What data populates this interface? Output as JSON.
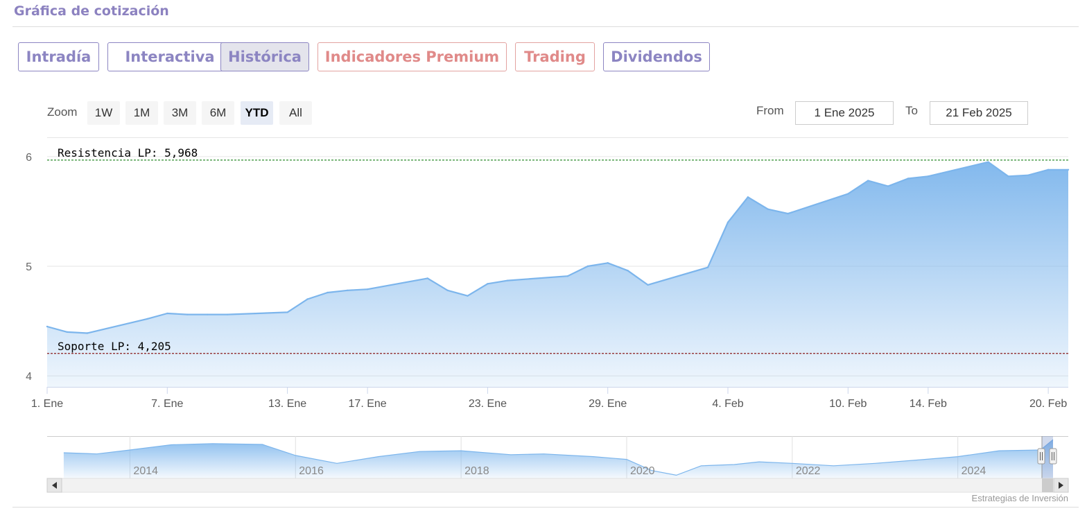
{
  "header": {
    "title": "Gráfica de cotización"
  },
  "tabs": [
    {
      "label": "Intradía"
    },
    {
      "label": "Interactiva"
    },
    {
      "label": "Histórica",
      "active": true
    },
    {
      "label": "Indicadores Premium"
    },
    {
      "label": "Trading"
    },
    {
      "label": "Dividendos"
    }
  ],
  "zoom": {
    "label": "Zoom",
    "buttons": [
      "1W",
      "1M",
      "3M",
      "6M",
      "YTD",
      "All"
    ],
    "selected": "YTD"
  },
  "range": {
    "from_label": "From",
    "from_value": "1 Ene 2025",
    "to_label": "To",
    "to_value": "21 Feb 2025"
  },
  "credits": "Estrategias de Inversión",
  "colors": {
    "accent": "#8c85c2",
    "premium": "#e08a89",
    "series": "#7cb5ec",
    "resistance": "#2e8b2e",
    "support": "#8b1c1c"
  },
  "chart_data": {
    "type": "area",
    "x": [
      "1. Ene",
      "2. Ene",
      "3. Ene",
      "6. Ene",
      "7. Ene",
      "8. Ene",
      "9. Ene",
      "10. Ene",
      "13. Ene",
      "14. Ene",
      "15. Ene",
      "16. Ene",
      "17. Ene",
      "20. Ene",
      "21. Ene",
      "22. Ene",
      "23. Ene",
      "24. Ene",
      "27. Ene",
      "28. Ene",
      "29. Ene",
      "30. Ene",
      "31. Ene",
      "3. Feb",
      "4. Feb",
      "5. Feb",
      "6. Feb",
      "7. Feb",
      "10. Feb",
      "11. Feb",
      "12. Feb",
      "13. Feb",
      "14. Feb",
      "17. Feb",
      "18. Feb",
      "19. Feb",
      "20. Feb",
      "21. Feb"
    ],
    "x_days": [
      0,
      1,
      2,
      5,
      6,
      7,
      8,
      9,
      12,
      13,
      14,
      15,
      16,
      19,
      20,
      21,
      22,
      23,
      26,
      27,
      28,
      29,
      30,
      33,
      34,
      35,
      36,
      37,
      40,
      41,
      42,
      43,
      44,
      47,
      48,
      49,
      50,
      51
    ],
    "series": [
      {
        "values": [
          4.45,
          4.4,
          4.39,
          4.52,
          4.57,
          4.56,
          4.56,
          4.56,
          4.58,
          4.7,
          4.76,
          4.78,
          4.79,
          4.89,
          4.78,
          4.73,
          4.84,
          4.87,
          4.91,
          5.0,
          5.03,
          4.96,
          4.83,
          4.99,
          5.4,
          5.63,
          5.52,
          5.48,
          5.66,
          5.78,
          5.73,
          5.8,
          5.82,
          5.95,
          5.82,
          5.83,
          5.88,
          5.88
        ]
      }
    ],
    "x_ticks": [
      "1. Ene",
      "7. Ene",
      "13. Ene",
      "17. Ene",
      "23. Ene",
      "29. Ene",
      "4. Feb",
      "10. Feb",
      "14. Feb",
      "20. Feb"
    ],
    "x_tick_days": [
      0,
      6,
      12,
      16,
      22,
      28,
      34,
      40,
      44,
      50
    ],
    "y_ticks": [
      4,
      5,
      6
    ],
    "ylim": [
      3.9,
      6.1
    ],
    "xlim": [
      0,
      51
    ],
    "plot_lines": [
      {
        "label": "Resistencia LP: 5,968",
        "value": 5.968,
        "color": "#2e8b2e"
      },
      {
        "label": "Soporte LP: 4,205",
        "value": 4.205,
        "color": "#8b1c1c"
      }
    ],
    "navigator": {
      "year_labels": [
        "2014",
        "2016",
        "2018",
        "2020",
        "2022",
        "2024"
      ],
      "year_values": [
        2014,
        2016,
        2018,
        2020,
        2022,
        2024
      ],
      "xlim": [
        2013.0,
        2025.15
      ],
      "x_years": [
        2013.2,
        2013.6,
        2014.0,
        2014.5,
        2015.0,
        2015.6,
        2016.0,
        2016.5,
        2017.0,
        2017.5,
        2018.0,
        2018.6,
        2019.0,
        2019.6,
        2020.0,
        2020.3,
        2020.6,
        2020.9,
        2021.3,
        2021.6,
        2022.0,
        2022.5,
        2023.0,
        2023.6,
        2024.0,
        2024.5,
        2025.0,
        2025.15
      ],
      "values": [
        0.65,
        0.62,
        0.72,
        0.85,
        0.88,
        0.86,
        0.58,
        0.38,
        0.55,
        0.68,
        0.7,
        0.6,
        0.62,
        0.55,
        0.48,
        0.2,
        0.08,
        0.32,
        0.35,
        0.42,
        0.38,
        0.32,
        0.38,
        0.48,
        0.55,
        0.7,
        0.72,
        0.98
      ]
    }
  }
}
